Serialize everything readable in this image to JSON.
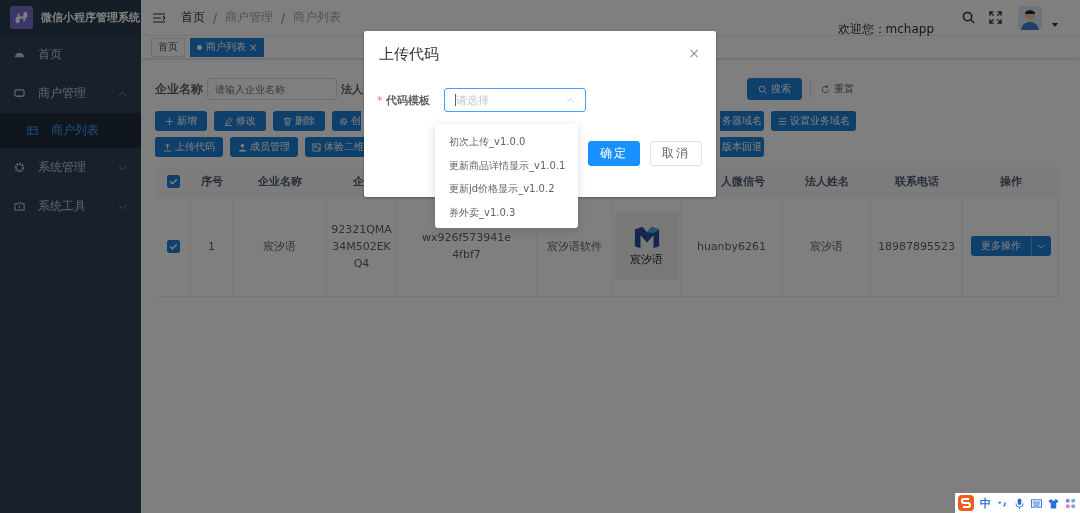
{
  "sidebar": {
    "title": "微信小程序管理系统",
    "items": [
      {
        "label": "首页",
        "selected": false
      },
      {
        "label": "商户管理",
        "selected": false,
        "expanded": true,
        "children": [
          {
            "label": "商户列表",
            "selected": true
          }
        ]
      },
      {
        "label": "系统管理",
        "selected": false,
        "expanded": false
      },
      {
        "label": "系统工具",
        "selected": false,
        "expanded": false
      }
    ]
  },
  "header": {
    "breadcrumb": [
      "首页",
      "商户管理",
      "商户列表"
    ],
    "separator": "/",
    "welcome": "欢迎您：mchapp"
  },
  "tags": [
    {
      "label": "首页",
      "selected": false
    },
    {
      "label": "商户列表",
      "selected": true,
      "close": "×"
    }
  ],
  "search": {
    "fields": [
      {
        "label": "企业名称",
        "placeholder": "请输入企业名称"
      },
      {
        "label": "法人"
      }
    ],
    "buttons": [
      {
        "label": "搜索",
        "kind": "primary"
      },
      {
        "label": "重置",
        "kind": "plain"
      }
    ]
  },
  "toolbar": [
    {
      "left": [
        {
          "label": "新增"
        },
        {
          "label": "修改"
        },
        {
          "label": "删除"
        },
        {
          "label": "创"
        }
      ],
      "right": [
        {
          "label": "务器域名"
        },
        {
          "label": "设置业务域名"
        }
      ]
    },
    {
      "left": [
        {
          "label": "上传代码"
        },
        {
          "label": "成员管理"
        },
        {
          "label": "体验二维"
        }
      ],
      "right": [
        {
          "label": "版本回退"
        }
      ]
    }
  ],
  "table": {
    "header_checked": true,
    "columns": [
      {
        "label": "序号"
      },
      {
        "label": "企业名称"
      },
      {
        "label": "企"
      },
      {},
      {},
      {},
      {
        "label": "人微信号"
      },
      {
        "label": "法人姓名"
      },
      {
        "label": "联系电话"
      },
      {
        "label": "操作"
      }
    ],
    "rows": [
      {
        "selected": true,
        "cells": [
          "1",
          "宸汐语",
          "92321QMA34M502EKQ4",
          "wx926f573941e4fbf7",
          "宸汐语软件",
          {
            "logo_text": "宸汐语"
          },
          "huanby6261",
          "宸汐语",
          "18987895523",
          {
            "action": "更多操作"
          }
        ]
      }
    ]
  },
  "modal": {
    "title": "上传代码",
    "close": "×",
    "field": {
      "label": "代码模板",
      "required_mark": "*",
      "placeholder": "请选择"
    },
    "options": [
      {
        "label": "初次上传_v1.0.0",
        "selected": false
      },
      {
        "label": "更新商品详情显示_v1.0.1",
        "selected": false
      },
      {
        "label": "更新jd价格显示_v1.0.2",
        "selected": false
      },
      {
        "label": "券外卖_v1.0.3",
        "selected": false
      }
    ],
    "buttons": [
      {
        "label": "确定",
        "kind": "primary"
      },
      {
        "label": "取消",
        "kind": "default"
      }
    ]
  },
  "ime": {
    "mode": "中"
  }
}
